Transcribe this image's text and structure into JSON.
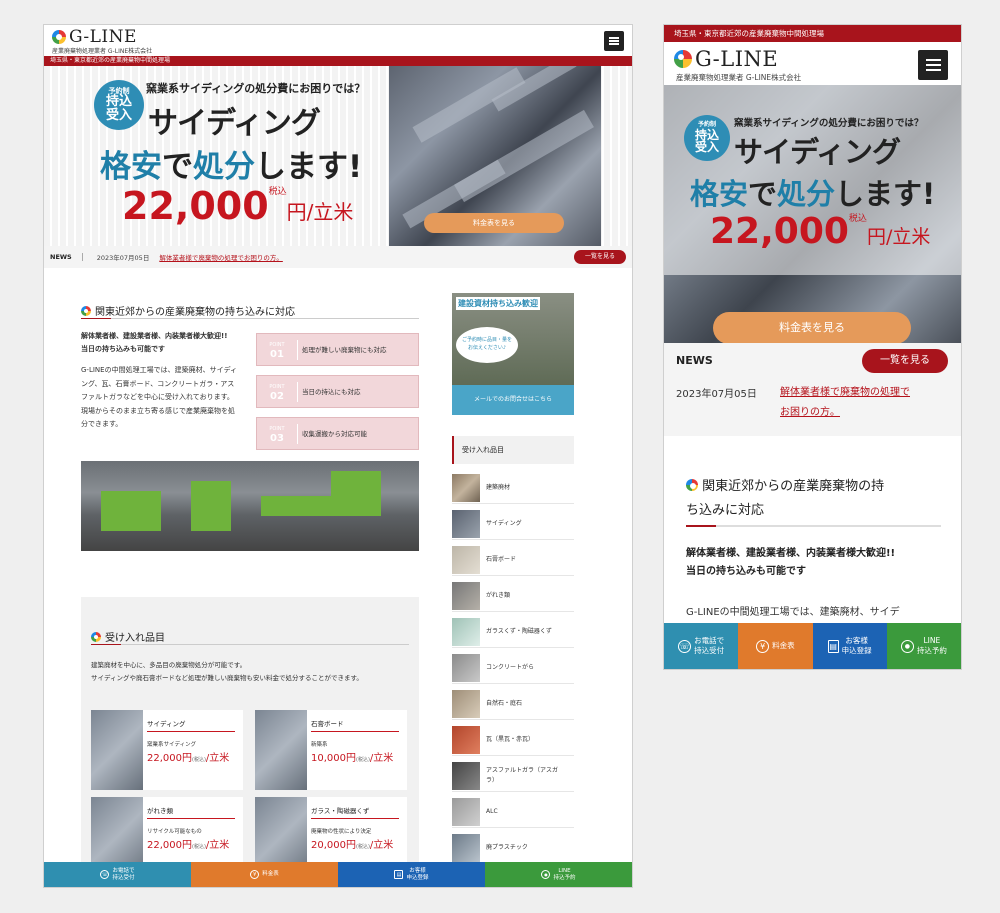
{
  "brand": {
    "name": "G-LINE",
    "desktop_sub": "産業廃棄物処理業者 G-LINE株式会社",
    "mobile_sub": "産業廃棄物処理業者 G-LINE株式会社"
  },
  "region_strip": "埼玉県・東京都近郊の産業廃棄物中間処理場",
  "hero": {
    "badge_top": "予約制",
    "badge_line1": "持込",
    "badge_line2": "受入",
    "question": "窯業系サイディングの処分費にお困りでは？",
    "main": "サイディング",
    "cheap_1": "格安",
    "cheap_2": "で",
    "cheap_3": "処分",
    "cheap_4": "します!",
    "price": "22,000",
    "tax": "税込",
    "unit": "円/立米",
    "price_button": "料金表を見る"
  },
  "news": {
    "label": "NEWS",
    "date": "2023年07月05日",
    "link": "解体業者様で廃棄物の処理でお困りの方。",
    "link_line1": "解体業者様で廃棄物の処理で",
    "link_line2": "お困りの方。",
    "more": "一覧を見る"
  },
  "intro": {
    "title": "関東近郊からの産業廃棄物の持ち込みに対応",
    "mobile_title_1": "関東近郊からの産業廃棄物の持",
    "mobile_title_2": "ち込みに対応",
    "lead_1": "解体業者様、建設業者様、内装業者様大歓迎!!",
    "lead_2": "当日の持ち込みも可能です",
    "body_1": "G-LINEの中間処理工場では、建築廃材、サイディ",
    "body_2": "ング、瓦、石膏ボード、コンクリートガラ・アス",
    "body_3": "ファルトガラなどを中心に受け入れております。",
    "body_4": "現場からそのまま立ち寄る感じで産業廃棄物を処",
    "body_5": "分できます。",
    "mobile_body": "G-LINEの中間処理工場では、建築廃材、サイデ"
  },
  "points": [
    {
      "label": "POINT",
      "num": "01",
      "text": "処理が難しい廃棄物にも対応"
    },
    {
      "label": "POINT",
      "num": "02",
      "text": "当日の持込にも対応"
    },
    {
      "label": "POINT",
      "num": "03",
      "text": "収集運搬から対応可能"
    }
  ],
  "accepted": {
    "title": "受け入れ品目",
    "desc_1": "建築廃材を中心に、多品目の廃棄物処分が可能です。",
    "desc_2": "サイディングや廃石膏ボードなど処理が難しい廃棄物も安い料金で処分することができます。",
    "yen": "(税込)",
    "cards": [
      {
        "name": "サイディング",
        "detail": "窯業系サイディング",
        "price": "22,000円",
        "unit": "/立米"
      },
      {
        "name": "石膏ボード",
        "detail": "新築系",
        "price": "10,000円",
        "unit": "/立米"
      },
      {
        "name": "がれき類",
        "detail": "リサイクル可能なもの",
        "price": "22,000円",
        "unit": "/立米"
      },
      {
        "name": "ガラス・陶磁器くず",
        "detail": "廃棄物の性状により決定",
        "price": "20,000円",
        "unit": "/立米"
      }
    ]
  },
  "sidebar": {
    "banner_title": "建設資材持ち込み歓迎",
    "banner_bubble_1": "ご予約時に品目・量を",
    "banner_bubble_2": "お伝えください♪",
    "banner_button": "メールでのお問合せはこちら",
    "list_title": "受け入れ品目",
    "items": [
      "建築廃材",
      "サイディング",
      "石膏ボード",
      "がれき類",
      "ガラスくず・陶磁器くず",
      "コンクリートがら",
      "自然石・庭石",
      "瓦（黒瓦・赤瓦）",
      "アスファルトガラ（アスガラ）",
      "ALC",
      "廃プラスチック"
    ]
  },
  "bottom_bar": [
    {
      "line1": "お電話で",
      "line2": "持込受付",
      "color": "#2f8fb0",
      "icon": "phone-icon"
    },
    {
      "line1": "料金表",
      "line2": "",
      "color": "#e07a2c",
      "icon": "yen-icon"
    },
    {
      "line1": "お客様",
      "line2": "申込登録",
      "color": "#1c63b4",
      "icon": "document-icon"
    },
    {
      "line1": "LINE",
      "line2": "持込予約",
      "color": "#3b9a3c",
      "icon": "line-icon"
    }
  ],
  "colors": {
    "accent": "#a8141c",
    "teal": "#2e8db5",
    "orange": "#e59a5a"
  }
}
